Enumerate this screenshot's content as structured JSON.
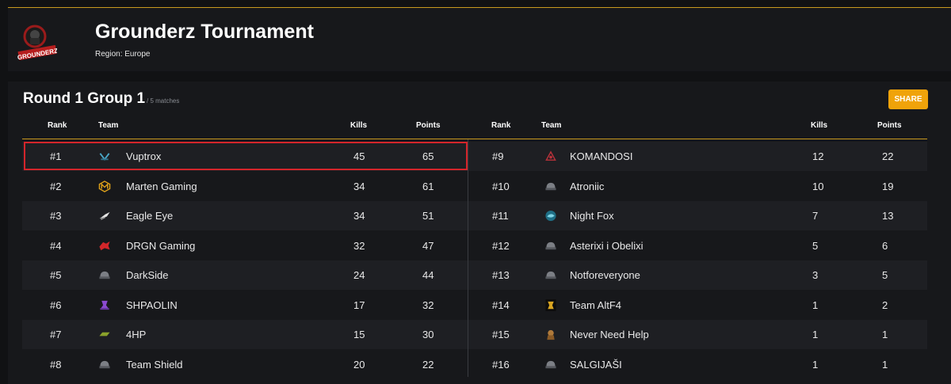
{
  "header": {
    "title": "Grounderz Tournament",
    "region": "Region: Europe",
    "logo_text": "GROUNDERZ"
  },
  "group": {
    "title": "Round 1 Group 1",
    "matches": "/ 5 matches",
    "share_label": "SHARE"
  },
  "columns": {
    "rank": "Rank",
    "team": "Team",
    "kills": "Kills",
    "points": "Points"
  },
  "left": [
    {
      "rank": "#1",
      "team": "Vuptrox",
      "kills": "45",
      "points": "65",
      "icon": "vuptrox-logo-icon"
    },
    {
      "rank": "#2",
      "team": "Marten Gaming",
      "kills": "34",
      "points": "61",
      "icon": "marten-logo-icon"
    },
    {
      "rank": "#3",
      "team": "Eagle Eye",
      "kills": "34",
      "points": "51",
      "icon": "eagle-logo-icon"
    },
    {
      "rank": "#4",
      "team": "DRGN Gaming",
      "kills": "32",
      "points": "47",
      "icon": "dragon-logo-icon"
    },
    {
      "rank": "#5",
      "team": "DarkSide",
      "kills": "24",
      "points": "44",
      "icon": "helmet-icon"
    },
    {
      "rank": "#6",
      "team": "SHPAOLIN",
      "kills": "17",
      "points": "32",
      "icon": "shpaolin-logo-icon"
    },
    {
      "rank": "#7",
      "team": "4HP",
      "kills": "15",
      "points": "30",
      "icon": "4hp-logo-icon"
    },
    {
      "rank": "#8",
      "team": "Team Shield",
      "kills": "20",
      "points": "22",
      "icon": "helmet-icon"
    }
  ],
  "right": [
    {
      "rank": "#9",
      "team": "KOMANDOSI",
      "kills": "12",
      "points": "22",
      "icon": "komandosi-logo-icon"
    },
    {
      "rank": "#10",
      "team": "Atroniic",
      "kills": "10",
      "points": "19",
      "icon": "helmet-icon"
    },
    {
      "rank": "#11",
      "team": "Night Fox",
      "kills": "7",
      "points": "13",
      "icon": "nightfox-logo-icon"
    },
    {
      "rank": "#12",
      "team": "Asterixi i Obelixi",
      "kills": "5",
      "points": "6",
      "icon": "helmet-icon"
    },
    {
      "rank": "#13",
      "team": "Notforeveryone",
      "kills": "3",
      "points": "5",
      "icon": "helmet-icon"
    },
    {
      "rank": "#14",
      "team": "Team AltF4",
      "kills": "1",
      "points": "2",
      "icon": "altf4-logo-icon"
    },
    {
      "rank": "#15",
      "team": "Never Need Help",
      "kills": "1",
      "points": "1",
      "icon": "nnh-logo-icon"
    },
    {
      "rank": "#16",
      "team": "SALGIJAŠI",
      "kills": "1",
      "points": "1",
      "icon": "helmet-icon"
    }
  ],
  "colors": {
    "accent": "#f0a30a",
    "gold_line": "#c99a1f",
    "highlight": "#d4252b",
    "panel": "#17181b",
    "row_alt": "#1e1f23"
  }
}
